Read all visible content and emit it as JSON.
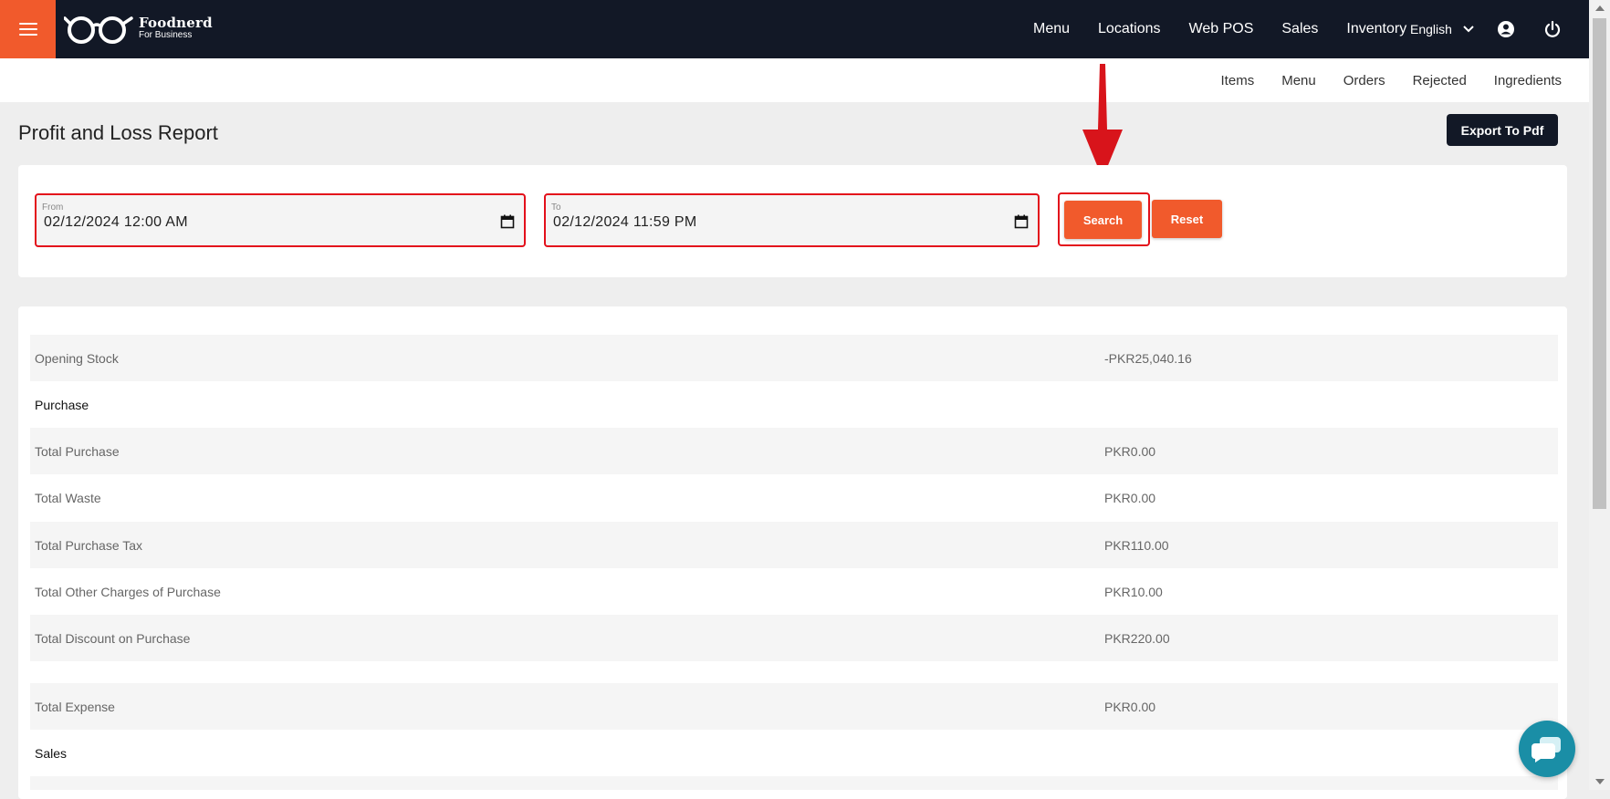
{
  "header": {
    "brand_name": "Foodnerd",
    "brand_sub": "For Business",
    "nav": [
      "Menu",
      "Locations",
      "Web POS",
      "Sales",
      "Inventory"
    ],
    "language": "English",
    "icons": [
      "menu-icon",
      "account-icon",
      "power-icon",
      "chevron-down-icon"
    ]
  },
  "subnav": [
    "Items",
    "Menu",
    "Orders",
    "Rejected",
    "Ingredients"
  ],
  "page": {
    "title": "Profit and Loss Report",
    "export_label": "Export To Pdf"
  },
  "filters": {
    "from_label": "From",
    "from_value": "02/12/2024 12:00 AM",
    "to_label": "To",
    "to_value": "02/12/2024 11:59 PM",
    "search_label": "Search",
    "reset_label": "Reset"
  },
  "report": {
    "rows": [
      {
        "label": "Opening Stock",
        "value": "-PKR25,040.16"
      },
      {
        "label": "Purchase",
        "value": ""
      },
      {
        "label": "Total Purchase",
        "value": "PKR0.00"
      },
      {
        "label": "Total Waste",
        "value": "PKR0.00"
      },
      {
        "label": "Total Purchase Tax",
        "value": "PKR110.00"
      },
      {
        "label": "Total Other Charges of Purchase",
        "value": "PKR10.00"
      },
      {
        "label": "Total Discount on Purchase",
        "value": "PKR220.00"
      },
      {
        "label": "Total Expense",
        "value": "PKR0.00"
      },
      {
        "label": "Sales",
        "value": ""
      }
    ]
  },
  "colors": {
    "navbar": "#121826",
    "accent": "#f15a2c",
    "highlight": "#e3101b",
    "chat": "#1a8ea6"
  }
}
